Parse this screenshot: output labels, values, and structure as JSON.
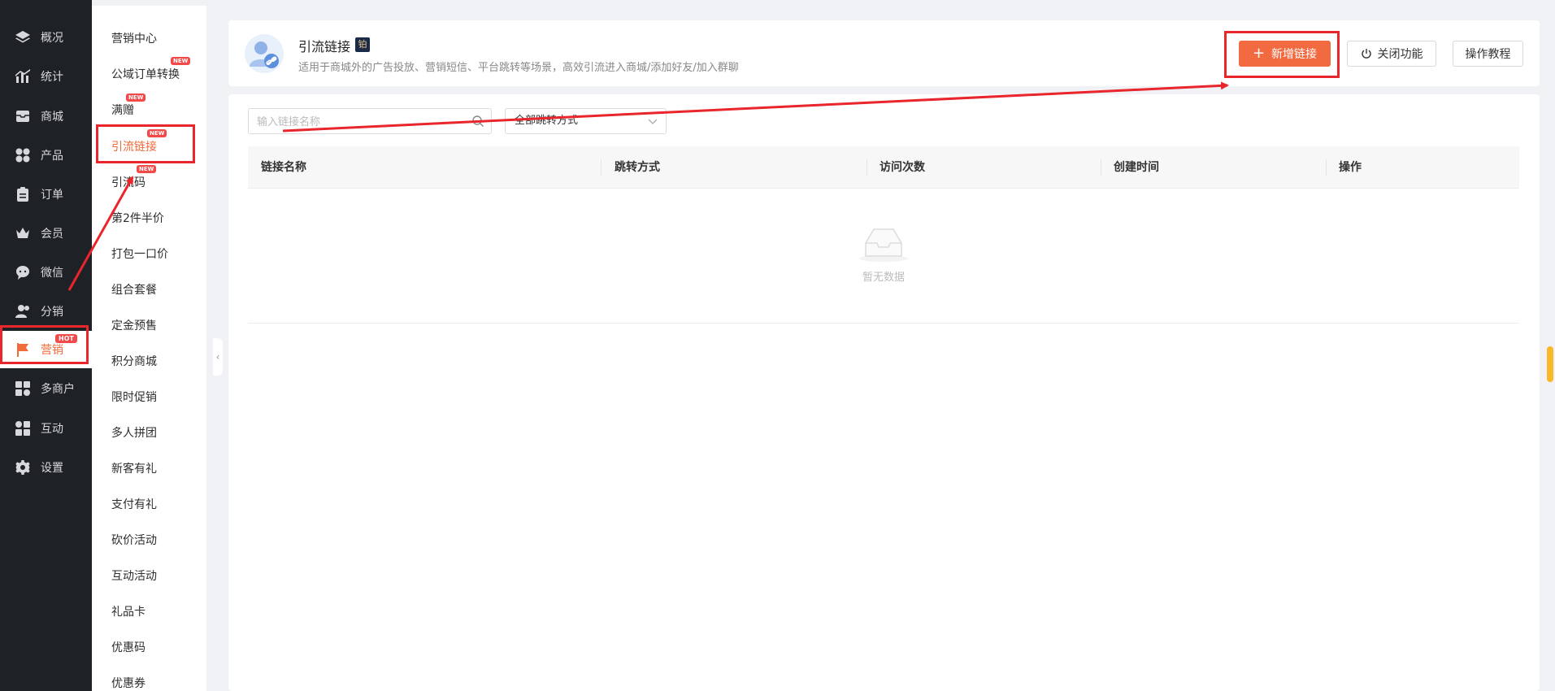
{
  "leftnav": {
    "items": [
      {
        "label": "概况",
        "icon": "layers-icon"
      },
      {
        "label": "统计",
        "icon": "chart-icon"
      },
      {
        "label": "商城",
        "icon": "mail-icon"
      },
      {
        "label": "产品",
        "icon": "grid-icon"
      },
      {
        "label": "订单",
        "icon": "clipboard-icon"
      },
      {
        "label": "会员",
        "icon": "crown-icon"
      },
      {
        "label": "微信",
        "icon": "chat-icon"
      },
      {
        "label": "分销",
        "icon": "users-icon"
      },
      {
        "label": "营销",
        "icon": "flag-icon",
        "badge": "HOT",
        "active": true
      },
      {
        "label": "多商户",
        "icon": "store-icon"
      },
      {
        "label": "互动",
        "icon": "interact-icon"
      },
      {
        "label": "设置",
        "icon": "gear-icon"
      }
    ]
  },
  "subnav": {
    "items": [
      {
        "label": "营销中心"
      },
      {
        "label": "公域订单转换",
        "badge": "NEW"
      },
      {
        "label": "满赠",
        "badge": "NEW"
      },
      {
        "label": "引流链接",
        "badge": "NEW",
        "active": true
      },
      {
        "label": "引流码",
        "badge": "NEW"
      },
      {
        "label": "第2件半价"
      },
      {
        "label": "打包一口价"
      },
      {
        "label": "组合套餐"
      },
      {
        "label": "定金预售"
      },
      {
        "label": "积分商城"
      },
      {
        "label": "限时促销"
      },
      {
        "label": "多人拼团"
      },
      {
        "label": "新客有礼"
      },
      {
        "label": "支付有礼"
      },
      {
        "label": "砍价活动"
      },
      {
        "label": "互动活动"
      },
      {
        "label": "礼品卡"
      },
      {
        "label": "优惠码"
      },
      {
        "label": "优惠券"
      }
    ]
  },
  "header": {
    "title": "引流链接",
    "plan_badge": "铂",
    "description": "适用于商城外的广告投放、营销短信、平台跳转等场景，高效引流进入商城/添加好友/加入群聊",
    "add_button": "新增链接",
    "close_button": "关闭功能",
    "tutorial_button": "操作教程"
  },
  "filters": {
    "search_placeholder": "输入链接名称",
    "jump_select_value": "全部跳转方式"
  },
  "table": {
    "columns": [
      "链接名称",
      "跳转方式",
      "访问次数",
      "创建时间",
      "操作"
    ],
    "empty_text": "暂无数据"
  },
  "colors": {
    "accent": "#f26a40",
    "nav_bg": "#1e2126",
    "annotation_red": "#e8262c",
    "scroll_thumb": "#f9b829"
  }
}
